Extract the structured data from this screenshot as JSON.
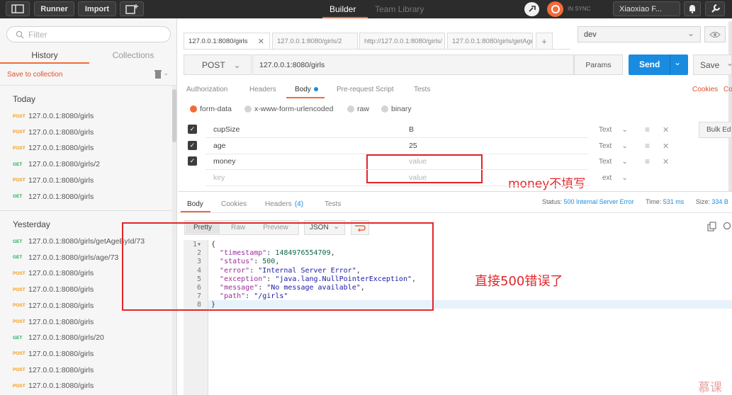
{
  "topbar": {
    "runner": "Runner",
    "import": "Import",
    "builder": "Builder",
    "team_library": "Team Library",
    "sync": "IN SYNC",
    "user": "Xiaoxiao F..."
  },
  "sidebar": {
    "filter_placeholder": "Filter",
    "tabs": [
      "History",
      "Collections"
    ],
    "save_to_collection": "Save to collection",
    "today": "Today",
    "yesterday": "Yesterday",
    "today_items": [
      {
        "method": "POST",
        "url": "127.0.0.1:8080/girls"
      },
      {
        "method": "POST",
        "url": "127.0.0.1:8080/girls"
      },
      {
        "method": "POST",
        "url": "127.0.0.1:8080/girls"
      },
      {
        "method": "GET",
        "url": "127.0.0.1:8080/girls/2"
      },
      {
        "method": "POST",
        "url": "127.0.0.1:8080/girls"
      },
      {
        "method": "GET",
        "url": "127.0.0.1:8080/girls"
      }
    ],
    "yesterday_items": [
      {
        "method": "GET",
        "url": "127.0.0.1:8080/girls/getAgeById/73"
      },
      {
        "method": "GET",
        "url": "127.0.0.1:8080/girls/age/73"
      },
      {
        "method": "POST",
        "url": "127.0.0.1:8080/girls"
      },
      {
        "method": "POST",
        "url": "127.0.0.1:8080/girls"
      },
      {
        "method": "POST",
        "url": "127.0.0.1:8080/girls"
      },
      {
        "method": "POST",
        "url": "127.0.0.1:8080/girls"
      },
      {
        "method": "GET",
        "url": "127.0.0.1:8080/girls/20"
      },
      {
        "method": "POST",
        "url": "127.0.0.1:8080/girls"
      },
      {
        "method": "POST",
        "url": "127.0.0.1:8080/girls"
      },
      {
        "method": "POST",
        "url": "127.0.0.1:8080/girls"
      }
    ]
  },
  "request_tabs": [
    "127.0.0.1:8080/girls",
    "127.0.0.1:8080/girls/2",
    "http://127.0.0.1:8080/girls/",
    "127.0.0.1:8080/girls/getAge"
  ],
  "environment": "dev",
  "request": {
    "method": "POST",
    "url": "127.0.0.1:8080/girls",
    "params": "Params",
    "send": "Send",
    "save": "Save"
  },
  "request_subtabs": {
    "authorization": "Authorization",
    "headers": "Headers",
    "body": "Body",
    "pre_request": "Pre-request Script",
    "tests": "Tests",
    "cookies": "Cookies",
    "code": "Co"
  },
  "body_types": [
    "form-data",
    "x-www-form-urlencoded",
    "raw",
    "binary"
  ],
  "form_rows": [
    {
      "key": "cupSize",
      "value": "B",
      "type": "Text"
    },
    {
      "key": "age",
      "value": "25",
      "type": "Text"
    },
    {
      "key": "money",
      "value": "value",
      "type": "Text"
    },
    {
      "key": "key",
      "value": "value",
      "type": "ext"
    }
  ],
  "bulk_edit": "Bulk Edi",
  "response_tabs": {
    "body": "Body",
    "cookies": "Cookies",
    "headers": "Headers",
    "headers_count": "(4)",
    "tests": "Tests"
  },
  "response_meta": {
    "status_label": "Status:",
    "status": "500 Internal Server Error",
    "time_label": "Time:",
    "time": "531 ms",
    "size_label": "Size:",
    "size": "334 B"
  },
  "view_buttons": [
    "Pretty",
    "Raw",
    "Preview"
  ],
  "format": "JSON",
  "code_lines": [
    "{",
    "  \"timestamp\": 1484976554709,",
    "  \"status\": 500,",
    "  \"error\": \"Internal Server Error\",",
    "  \"exception\": \"java.lang.NullPointerException\",",
    "  \"message\": \"No message available\",",
    "  \"path\": \"/girls\"",
    "}"
  ],
  "code_parts": [
    {
      "k": "",
      "v": ""
    },
    {
      "k": "\"timestamp\"",
      "v": "1484976554709"
    },
    {
      "k": "\"status\"",
      "v": "500"
    },
    {
      "k": "\"error\"",
      "v": "\"Internal Server Error\""
    },
    {
      "k": "\"exception\"",
      "v": "\"java.lang.NullPointerException\""
    },
    {
      "k": "\"message\"",
      "v": "\"No message available\""
    },
    {
      "k": "\"path\"",
      "v": "\"/girls\""
    },
    {
      "k": "",
      "v": ""
    }
  ],
  "annotations": {
    "money_note": "money不填写",
    "error_note": "直接500错误了"
  },
  "watermark": "慕课"
}
